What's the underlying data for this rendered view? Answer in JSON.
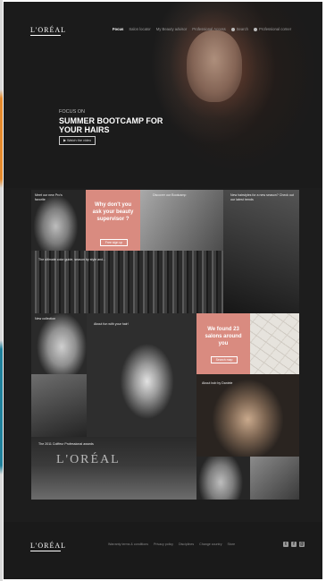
{
  "brand": {
    "logo": "L'ORÉAL",
    "footer_logo": "L'ORÉAL"
  },
  "nav": {
    "items": [
      "Focus",
      "Salon locator",
      "My Beauty advisor",
      "Professional Access",
      "Search",
      "Professional corner"
    ],
    "active": "Focus"
  },
  "hero": {
    "kicker": "FOCUS ON",
    "title": "SUMMER BOOTCAMP FOR YOUR HAIRS",
    "button": "Watch the video"
  },
  "tiles": {
    "t1_caption": "Meet our new Pro's favorite",
    "pink1_title": "Why don't you ask your beauty supervisor ?",
    "pink1_button": "Free sign up",
    "t2_caption": "Discover our Bootcamp",
    "t3_caption": "New hairstyles for a new season? Check out our latest trends",
    "rack_caption": "The ultimate color guide, season by style and...",
    "t4_caption": "New collection",
    "t5_caption": "About fun with your hair!",
    "pink2_title": "We found 23 salons around you",
    "pink2_button": "Search map",
    "t6_caption": "About bob by Daniele",
    "stage_caption": "The 2011 Coiffeur Professional awards",
    "stage_text": "L'ORÉAL"
  },
  "footer": {
    "links": [
      "Warranty terms & conditions",
      "Privacy policy",
      "Disciplines",
      "Change country",
      "Store"
    ],
    "social": [
      "twitter",
      "facebook",
      "email"
    ]
  },
  "colors": {
    "accent_pink": "#d98b80",
    "background": "#1d1d1d"
  }
}
